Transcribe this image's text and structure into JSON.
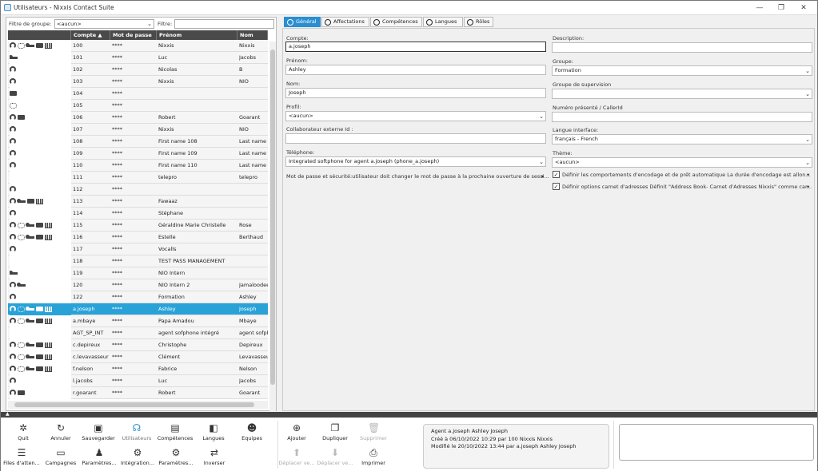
{
  "window": {
    "title": "Utilisateurs - Nixxis Contact Suite",
    "minimize": "—",
    "restore": "❐",
    "close": "✕"
  },
  "filter": {
    "group_label": "Filtre de groupe:",
    "group_value": "<aucun>",
    "filter_label": "Filtre:",
    "filter_value": ""
  },
  "grid": {
    "columns": [
      "Compte ▲",
      "Mot de passe",
      "Prénom",
      "Nom"
    ],
    "rows": [
      {
        "icons": [
          "headset-icon",
          "agents-icon",
          "key-icon",
          "card-icon",
          "chart-icon"
        ],
        "account": "100",
        "password": "****",
        "first": "Nixxis",
        "last": "Nixxis"
      },
      {
        "icons": [
          "key-icon"
        ],
        "account": "101",
        "password": "****",
        "first": "Luc",
        "last": "Jacobs"
      },
      {
        "icons": [
          "headset-icon"
        ],
        "account": "102",
        "password": "****",
        "first": "Nicolas",
        "last": "B"
      },
      {
        "icons": [
          "headset-icon"
        ],
        "account": "103",
        "password": "****",
        "first": "Nixxis",
        "last": "NIO"
      },
      {
        "icons": [
          "card-icon"
        ],
        "account": "104",
        "password": "****",
        "first": "",
        "last": ""
      },
      {
        "icons": [
          "agents-icon"
        ],
        "account": "105",
        "password": "****",
        "first": "",
        "last": ""
      },
      {
        "icons": [
          "headset-icon",
          "card-icon"
        ],
        "account": "106",
        "password": "****",
        "first": "Robert",
        "last": "Goarant"
      },
      {
        "icons": [
          "headset-icon"
        ],
        "account": "107",
        "password": "****",
        "first": "Nixxis",
        "last": "NIO"
      },
      {
        "icons": [
          "headset-icon"
        ],
        "account": "108",
        "password": "****",
        "first": "First name 108",
        "last": "Last name"
      },
      {
        "icons": [
          "headset-icon"
        ],
        "account": "109",
        "password": "****",
        "first": "First name 109",
        "last": "Last name"
      },
      {
        "icons": [
          "headset-icon"
        ],
        "account": "110",
        "password": "****",
        "first": "First name 110",
        "last": "Last name"
      },
      {
        "icons": [],
        "account": "111",
        "password": "****",
        "first": "telepro",
        "last": "telepro"
      },
      {
        "icons": [
          "headset-icon"
        ],
        "account": "112",
        "password": "****",
        "first": "",
        "last": ""
      },
      {
        "icons": [
          "headset-icon",
          "key-icon",
          "card-icon",
          "chart-icon"
        ],
        "account": "113",
        "password": "****",
        "first": "Fawaaz",
        "last": ""
      },
      {
        "icons": [
          "headset-icon"
        ],
        "account": "114",
        "password": "****",
        "first": "Stéphane",
        "last": ""
      },
      {
        "icons": [
          "headset-icon",
          "agents-icon",
          "key-icon",
          "card-icon",
          "chart-icon"
        ],
        "account": "115",
        "password": "****",
        "first": "Géraldine Marie Christelle",
        "last": "Rose"
      },
      {
        "icons": [
          "headset-icon",
          "agents-icon",
          "key-icon",
          "card-icon",
          "chart-icon"
        ],
        "account": "116",
        "password": "****",
        "first": "Estelle",
        "last": "Berthaud"
      },
      {
        "icons": [
          "headset-icon"
        ],
        "account": "117",
        "password": "****",
        "first": "Vocalls",
        "last": ""
      },
      {
        "icons": [],
        "account": "118",
        "password": "****",
        "first": "TEST PASS MANAGEMENT",
        "last": ""
      },
      {
        "icons": [
          "key-icon"
        ],
        "account": "119",
        "password": "****",
        "first": "NIO Intern",
        "last": ""
      },
      {
        "icons": [
          "headset-icon",
          "key-icon"
        ],
        "account": "120",
        "password": "****",
        "first": "NIO Intern 2",
        "last": "Jamaloodeen"
      },
      {
        "icons": [
          "headset-icon"
        ],
        "account": "122",
        "password": "****",
        "first": "Formation",
        "last": "Ashley"
      },
      {
        "icons": [
          "headset-icon",
          "agents-icon",
          "key-icon",
          "card-icon",
          "chart-icon"
        ],
        "account": "a.joseph",
        "password": "****",
        "first": "Ashley",
        "last": "Joseph",
        "selected": true
      },
      {
        "icons": [
          "headset-icon",
          "agents-icon",
          "key-icon",
          "card-icon",
          "chart-icon"
        ],
        "account": "a.mbaye",
        "password": "****",
        "first": "Papa Amadou",
        "last": "Mbaye"
      },
      {
        "icons": [],
        "account": "AGT_SP_INT",
        "password": "****",
        "first": "agent sofphone intégré",
        "last": "agent sofphone"
      },
      {
        "icons": [
          "headset-icon",
          "agents-icon",
          "key-icon",
          "card-icon",
          "chart-icon"
        ],
        "account": "c.depireux",
        "password": "****",
        "first": "Christophe",
        "last": "Depireux"
      },
      {
        "icons": [
          "headset-icon",
          "agents-icon",
          "key-icon",
          "card-icon",
          "chart-icon"
        ],
        "account": "c.levavasseur",
        "password": "****",
        "first": "Clément",
        "last": "Levavasseur"
      },
      {
        "icons": [
          "headset-icon",
          "agents-icon",
          "key-icon",
          "card-icon",
          "chart-icon"
        ],
        "account": "f.nelson",
        "password": "****",
        "first": "Fabrice",
        "last": "Nelson"
      },
      {
        "icons": [
          "headset-icon"
        ],
        "account": "l.jacobs",
        "password": "****",
        "first": "Luc",
        "last": "Jacobs"
      },
      {
        "icons": [
          "headset-icon",
          "card-icon"
        ],
        "account": "r.goarant",
        "password": "****",
        "first": "Robert",
        "last": "Goarant"
      }
    ]
  },
  "tabs": [
    "Général",
    "Affectations",
    "Compétences",
    "Langues",
    "Rôles"
  ],
  "form": {
    "compte_label": "Compte:",
    "compte_value": "a.joseph",
    "prenom_label": "Prénom:",
    "prenom_value": "Ashley",
    "nom_label": "Nom:",
    "nom_value": "Joseph",
    "profil_label": "Profil:",
    "profil_value": "<aucun>",
    "extid_label": "Collaborateur externe Id :",
    "extid_value": "",
    "tel_label": "Téléphone:",
    "tel_value": "Integrated softphone for agent a.joseph (phone_a.joseph)",
    "pwd_text": "Mot de passe et sécurité:utilisateur doit changer le mot de passe à la prochaine ouverture de sessi...",
    "desc_label": "Description:",
    "desc_value": "",
    "groupe_label": "Groupe:",
    "groupe_value": "Formation",
    "supgroup_label": "Groupe de supervision",
    "supgroup_value": "",
    "callerid_label": "Numéro présenté / CallerId",
    "callerid_value": "",
    "lang_label": "Langue interface:",
    "lang_value": "français - French",
    "theme_label": "Thème:",
    "theme_value": "<aucun>",
    "chk1_text": "Définir les comportements d'encodage et de prêt automatique  La durée d'encodage est allon...",
    "chk2_text": "Définir options carnet d'adresses  Définit \"Address Book- Carnet d'Adresses Nixxis\" comme car..."
  },
  "toolbar": {
    "row1": [
      "Quit",
      "Annuler",
      "Sauvegarder",
      "Utilisateurs",
      "Compétences",
      "Langues",
      "Equipes"
    ],
    "row2": [
      "Files d'atten...",
      "Campagnes",
      "Paramètres...",
      "Intégration...",
      "Paramètres...",
      "Inverser"
    ],
    "actions1": [
      "Ajouter",
      "Dupliquer",
      "Supprimer"
    ],
    "actions2": [
      "Déplacer ve...",
      "Déplacer ve...",
      "Imprimer"
    ]
  },
  "info": {
    "line1": "Agent a.joseph Ashley Joseph",
    "line2": "Créé à 06/10/2022 10:29 par 100 Nixxis Nixxis",
    "line3": "Modifié le 20/10/2022 13:44 par a.joseph Ashley Joseph"
  }
}
